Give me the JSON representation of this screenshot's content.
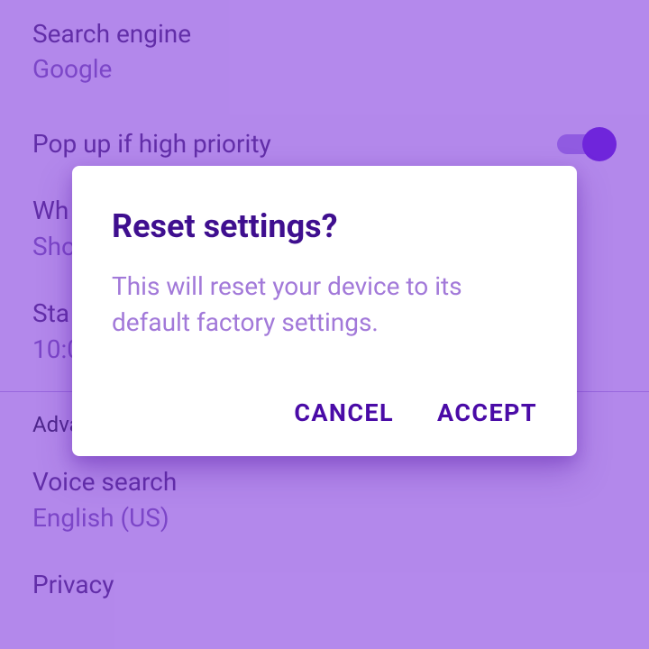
{
  "settings": [
    {
      "title": "Search engine",
      "subtitle": "Google"
    },
    {
      "title": "Pop up if high priority",
      "toggle": true
    },
    {
      "title": "Wh",
      "subtitle": "Sho"
    },
    {
      "title": "Sta",
      "subtitle": "10:0"
    }
  ],
  "sectionHeader": "Adva",
  "advanced": [
    {
      "title": "Voice search",
      "subtitle": "English (US)"
    },
    {
      "title": "Privacy"
    }
  ],
  "dialog": {
    "title": "Reset settings?",
    "body": "This will reset your device to its default factory settings.",
    "cancel": "CANCEL",
    "accept": "ACCEPT"
  }
}
